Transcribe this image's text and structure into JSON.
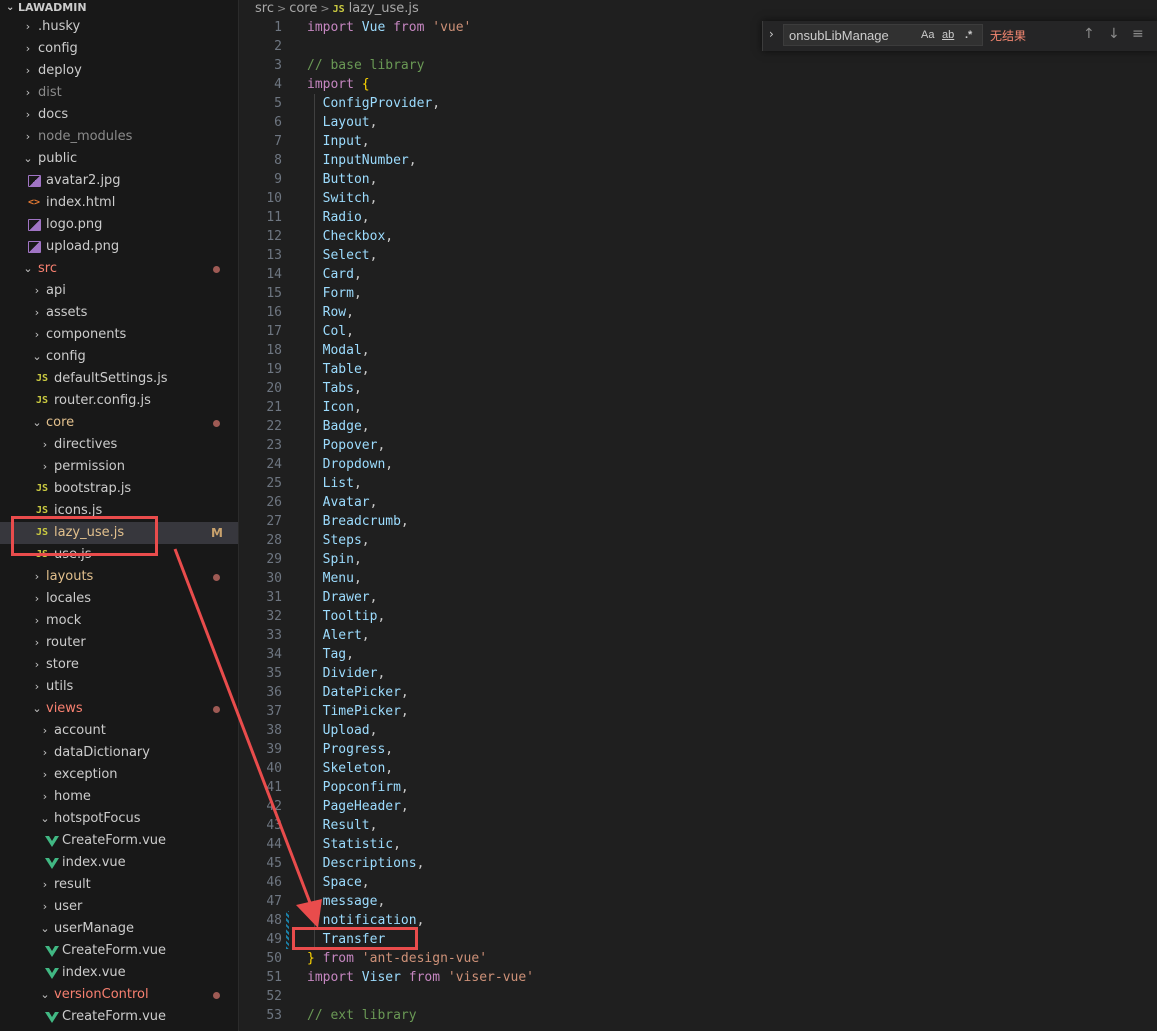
{
  "explorer": {
    "title": "LAWADMIN",
    "items": [
      {
        "label": ".husky",
        "kind": "folder",
        "depth": 0,
        "open": false
      },
      {
        "label": "config",
        "kind": "folder",
        "depth": 0,
        "open": false
      },
      {
        "label": "deploy",
        "kind": "folder",
        "depth": 0,
        "open": false
      },
      {
        "label": "dist",
        "kind": "folder",
        "depth": 0,
        "open": false,
        "dim": true
      },
      {
        "label": "docs",
        "kind": "folder",
        "depth": 0,
        "open": false
      },
      {
        "label": "node_modules",
        "kind": "folder",
        "depth": 0,
        "open": false,
        "dim": true
      },
      {
        "label": "public",
        "kind": "folder",
        "depth": 0,
        "open": true
      },
      {
        "label": "avatar2.jpg",
        "kind": "image",
        "depth": 1
      },
      {
        "label": "index.html",
        "kind": "html",
        "depth": 1
      },
      {
        "label": "logo.png",
        "kind": "image",
        "depth": 1
      },
      {
        "label": "upload.png",
        "kind": "image",
        "depth": 1
      },
      {
        "label": "src",
        "kind": "folder",
        "depth": 0,
        "open": true,
        "red": true,
        "dot": true
      },
      {
        "label": "api",
        "kind": "folder",
        "depth": 1,
        "open": false
      },
      {
        "label": "assets",
        "kind": "folder",
        "depth": 1,
        "open": false
      },
      {
        "label": "components",
        "kind": "folder",
        "depth": 1,
        "open": false
      },
      {
        "label": "config",
        "kind": "folder",
        "depth": 1,
        "open": true
      },
      {
        "label": "defaultSettings.js",
        "kind": "js",
        "depth": 2
      },
      {
        "label": "router.config.js",
        "kind": "js",
        "depth": 2
      },
      {
        "label": "core",
        "kind": "folder",
        "depth": 1,
        "open": true,
        "yellow": true,
        "dot": true
      },
      {
        "label": "directives",
        "kind": "folder",
        "depth": 2,
        "open": false
      },
      {
        "label": "permission",
        "kind": "folder",
        "depth": 2,
        "open": false
      },
      {
        "label": "bootstrap.js",
        "kind": "js",
        "depth": 2
      },
      {
        "label": "icons.js",
        "kind": "js",
        "depth": 2
      },
      {
        "label": "lazy_use.js",
        "kind": "js",
        "depth": 2,
        "yellow": true,
        "selected": true,
        "mflag": "M"
      },
      {
        "label": "use.js",
        "kind": "js",
        "depth": 2
      },
      {
        "label": "layouts",
        "kind": "folder",
        "depth": 1,
        "open": false,
        "yellow": true,
        "dot": true
      },
      {
        "label": "locales",
        "kind": "folder",
        "depth": 1,
        "open": false
      },
      {
        "label": "mock",
        "kind": "folder",
        "depth": 1,
        "open": false
      },
      {
        "label": "router",
        "kind": "folder",
        "depth": 1,
        "open": false
      },
      {
        "label": "store",
        "kind": "folder",
        "depth": 1,
        "open": false
      },
      {
        "label": "utils",
        "kind": "folder",
        "depth": 1,
        "open": false
      },
      {
        "label": "views",
        "kind": "folder",
        "depth": 1,
        "open": true,
        "red": true,
        "dot": true
      },
      {
        "label": "account",
        "kind": "folder",
        "depth": 2,
        "open": false
      },
      {
        "label": "dataDictionary",
        "kind": "folder",
        "depth": 2,
        "open": false
      },
      {
        "label": "exception",
        "kind": "folder",
        "depth": 2,
        "open": false
      },
      {
        "label": "home",
        "kind": "folder",
        "depth": 2,
        "open": false
      },
      {
        "label": "hotspotFocus",
        "kind": "folder",
        "depth": 2,
        "open": true
      },
      {
        "label": "CreateForm.vue",
        "kind": "vue",
        "depth": 3
      },
      {
        "label": "index.vue",
        "kind": "vue",
        "depth": 3
      },
      {
        "label": "result",
        "kind": "folder",
        "depth": 2,
        "open": false
      },
      {
        "label": "user",
        "kind": "folder",
        "depth": 2,
        "open": false
      },
      {
        "label": "userManage",
        "kind": "folder",
        "depth": 2,
        "open": true
      },
      {
        "label": "CreateForm.vue",
        "kind": "vue",
        "depth": 3
      },
      {
        "label": "index.vue",
        "kind": "vue",
        "depth": 3
      },
      {
        "label": "versionControl",
        "kind": "folder",
        "depth": 2,
        "open": true,
        "red": true,
        "dot": true
      },
      {
        "label": "CreateForm.vue",
        "kind": "vue",
        "depth": 3
      }
    ]
  },
  "breadcrumb": {
    "parts": [
      "src",
      "core"
    ],
    "file": "lazy_use.js",
    "file_icon": "JS"
  },
  "find": {
    "query": "onsubLibManage",
    "match_case": "Aa",
    "whole_word": "ab",
    "regex": ".*",
    "result": "无结果"
  },
  "code_lines": [
    {
      "n": "1",
      "tokens": [
        [
          "kw",
          "import "
        ],
        [
          "id",
          "Vue "
        ],
        [
          "kw",
          "from "
        ],
        [
          "str",
          "'vue'"
        ]
      ]
    },
    {
      "n": "2",
      "tokens": []
    },
    {
      "n": "3",
      "tokens": [
        [
          "cmt",
          "// base library"
        ]
      ]
    },
    {
      "n": "4",
      "tokens": [
        [
          "kw",
          "import "
        ],
        [
          "br",
          "{"
        ]
      ]
    },
    {
      "n": "5",
      "tokens": [
        [
          "id",
          "  ConfigProvider"
        ],
        [
          "p",
          ","
        ]
      ]
    },
    {
      "n": "6",
      "tokens": [
        [
          "id",
          "  Layout"
        ],
        [
          "p",
          ","
        ]
      ]
    },
    {
      "n": "7",
      "tokens": [
        [
          "id",
          "  Input"
        ],
        [
          "p",
          ","
        ]
      ]
    },
    {
      "n": "8",
      "tokens": [
        [
          "id",
          "  InputNumber"
        ],
        [
          "p",
          ","
        ]
      ]
    },
    {
      "n": "9",
      "tokens": [
        [
          "id",
          "  Button"
        ],
        [
          "p",
          ","
        ]
      ]
    },
    {
      "n": "10",
      "tokens": [
        [
          "id",
          "  Switch"
        ],
        [
          "p",
          ","
        ]
      ]
    },
    {
      "n": "11",
      "tokens": [
        [
          "id",
          "  Radio"
        ],
        [
          "p",
          ","
        ]
      ]
    },
    {
      "n": "12",
      "tokens": [
        [
          "id",
          "  Checkbox"
        ],
        [
          "p",
          ","
        ]
      ]
    },
    {
      "n": "13",
      "tokens": [
        [
          "id",
          "  Select"
        ],
        [
          "p",
          ","
        ]
      ]
    },
    {
      "n": "14",
      "tokens": [
        [
          "id",
          "  Card"
        ],
        [
          "p",
          ","
        ]
      ]
    },
    {
      "n": "15",
      "tokens": [
        [
          "id",
          "  Form"
        ],
        [
          "p",
          ","
        ]
      ]
    },
    {
      "n": "16",
      "tokens": [
        [
          "id",
          "  Row"
        ],
        [
          "p",
          ","
        ]
      ]
    },
    {
      "n": "17",
      "tokens": [
        [
          "id",
          "  Col"
        ],
        [
          "p",
          ","
        ]
      ]
    },
    {
      "n": "18",
      "tokens": [
        [
          "id",
          "  Modal"
        ],
        [
          "p",
          ","
        ]
      ]
    },
    {
      "n": "19",
      "tokens": [
        [
          "id",
          "  Table"
        ],
        [
          "p",
          ","
        ]
      ]
    },
    {
      "n": "20",
      "tokens": [
        [
          "id",
          "  Tabs"
        ],
        [
          "p",
          ","
        ]
      ]
    },
    {
      "n": "21",
      "tokens": [
        [
          "id",
          "  Icon"
        ],
        [
          "p",
          ","
        ]
      ]
    },
    {
      "n": "22",
      "tokens": [
        [
          "id",
          "  Badge"
        ],
        [
          "p",
          ","
        ]
      ]
    },
    {
      "n": "23",
      "tokens": [
        [
          "id",
          "  Popover"
        ],
        [
          "p",
          ","
        ]
      ]
    },
    {
      "n": "24",
      "tokens": [
        [
          "id",
          "  Dropdown"
        ],
        [
          "p",
          ","
        ]
      ]
    },
    {
      "n": "25",
      "tokens": [
        [
          "id",
          "  List"
        ],
        [
          "p",
          ","
        ]
      ]
    },
    {
      "n": "26",
      "tokens": [
        [
          "id",
          "  Avatar"
        ],
        [
          "p",
          ","
        ]
      ]
    },
    {
      "n": "27",
      "tokens": [
        [
          "id",
          "  Breadcrumb"
        ],
        [
          "p",
          ","
        ]
      ]
    },
    {
      "n": "28",
      "tokens": [
        [
          "id",
          "  Steps"
        ],
        [
          "p",
          ","
        ]
      ]
    },
    {
      "n": "29",
      "tokens": [
        [
          "id",
          "  Spin"
        ],
        [
          "p",
          ","
        ]
      ]
    },
    {
      "n": "30",
      "tokens": [
        [
          "id",
          "  Menu"
        ],
        [
          "p",
          ","
        ]
      ]
    },
    {
      "n": "31",
      "tokens": [
        [
          "id",
          "  Drawer"
        ],
        [
          "p",
          ","
        ]
      ]
    },
    {
      "n": "32",
      "tokens": [
        [
          "id",
          "  Tooltip"
        ],
        [
          "p",
          ","
        ]
      ]
    },
    {
      "n": "33",
      "tokens": [
        [
          "id",
          "  Alert"
        ],
        [
          "p",
          ","
        ]
      ]
    },
    {
      "n": "34",
      "tokens": [
        [
          "id",
          "  Tag"
        ],
        [
          "p",
          ","
        ]
      ]
    },
    {
      "n": "35",
      "tokens": [
        [
          "id",
          "  Divider"
        ],
        [
          "p",
          ","
        ]
      ]
    },
    {
      "n": "36",
      "tokens": [
        [
          "id",
          "  DatePicker"
        ],
        [
          "p",
          ","
        ]
      ]
    },
    {
      "n": "37",
      "tokens": [
        [
          "id",
          "  TimePicker"
        ],
        [
          "p",
          ","
        ]
      ]
    },
    {
      "n": "38",
      "tokens": [
        [
          "id",
          "  Upload"
        ],
        [
          "p",
          ","
        ]
      ]
    },
    {
      "n": "39",
      "tokens": [
        [
          "id",
          "  Progress"
        ],
        [
          "p",
          ","
        ]
      ]
    },
    {
      "n": "40",
      "tokens": [
        [
          "id",
          "  Skeleton"
        ],
        [
          "p",
          ","
        ]
      ]
    },
    {
      "n": "41",
      "tokens": [
        [
          "id",
          "  Popconfirm"
        ],
        [
          "p",
          ","
        ]
      ]
    },
    {
      "n": "42",
      "tokens": [
        [
          "id",
          "  PageHeader"
        ],
        [
          "p",
          ","
        ]
      ]
    },
    {
      "n": "43",
      "tokens": [
        [
          "id",
          "  Result"
        ],
        [
          "p",
          ","
        ]
      ]
    },
    {
      "n": "44",
      "tokens": [
        [
          "id",
          "  Statistic"
        ],
        [
          "p",
          ","
        ]
      ]
    },
    {
      "n": "45",
      "tokens": [
        [
          "id",
          "  Descriptions"
        ],
        [
          "p",
          ","
        ]
      ]
    },
    {
      "n": "46",
      "tokens": [
        [
          "id",
          "  Space"
        ],
        [
          "p",
          ","
        ]
      ]
    },
    {
      "n": "47",
      "tokens": [
        [
          "id",
          "  message"
        ],
        [
          "p",
          ","
        ]
      ]
    },
    {
      "n": "48",
      "tokens": [
        [
          "id",
          "  notification"
        ],
        [
          "p",
          ","
        ]
      ]
    },
    {
      "n": "49",
      "tokens": [
        [
          "id",
          "  Transfer"
        ]
      ]
    },
    {
      "n": "50",
      "tokens": [
        [
          "br",
          "} "
        ],
        [
          "kw",
          "from "
        ],
        [
          "str",
          "'ant-design-vue'"
        ]
      ]
    },
    {
      "n": "51",
      "tokens": [
        [
          "kw",
          "import "
        ],
        [
          "id",
          "Viser "
        ],
        [
          "kw",
          "from "
        ],
        [
          "str",
          "'viser-vue'"
        ]
      ]
    },
    {
      "n": "52",
      "tokens": []
    },
    {
      "n": "53",
      "tokens": [
        [
          "cmt",
          "// ext library"
        ]
      ]
    }
  ],
  "colors": {
    "annotation": "#e94c4c",
    "accent_selected": "#37373d",
    "modified": "#c9a26d"
  }
}
